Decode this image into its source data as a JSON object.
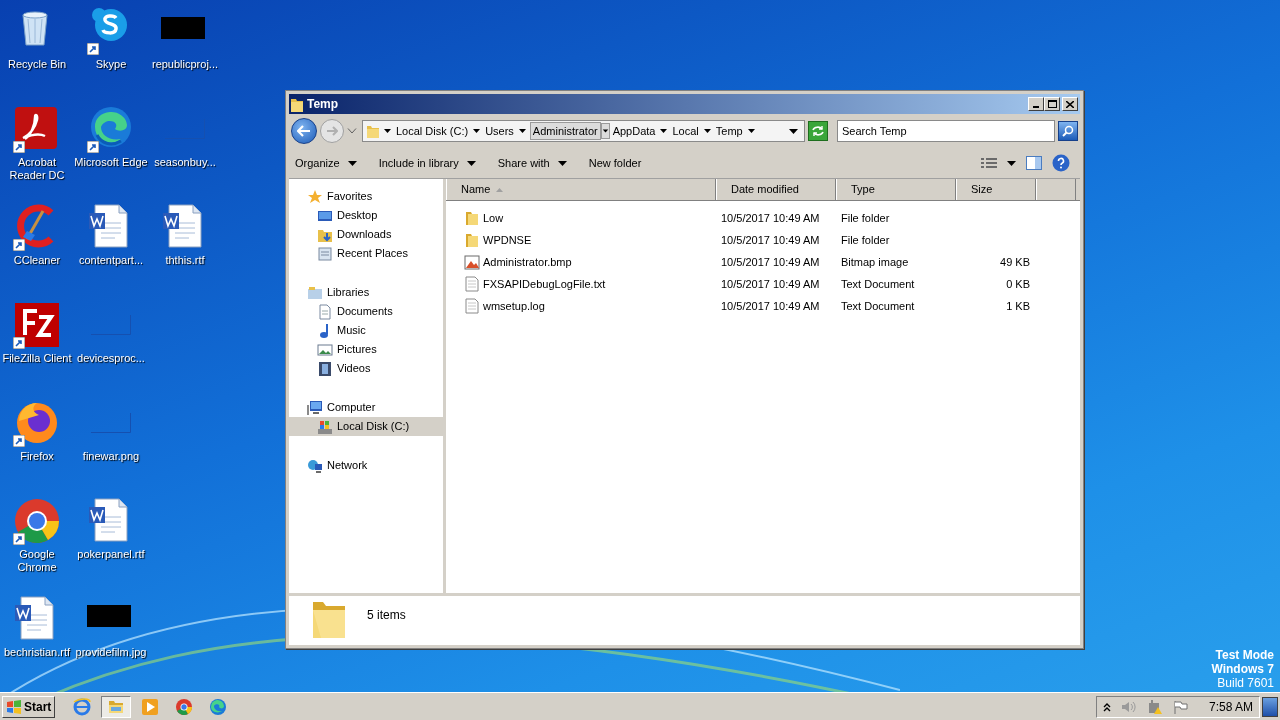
{
  "desktop": {
    "rows": [
      [
        {
          "label": "Recycle Bin",
          "kind": "recycle",
          "shortcut": false
        },
        {
          "label": "Skype",
          "kind": "skype",
          "shortcut": true
        },
        {
          "label": "republicproj...",
          "kind": "dark-thumb",
          "shortcut": false
        }
      ],
      [
        {
          "label": "Acrobat Reader DC",
          "kind": "acrobat",
          "shortcut": true
        },
        {
          "label": "Microsoft Edge",
          "kind": "edge",
          "shortcut": true
        },
        {
          "label": "seasonbuy...",
          "kind": "blank-thumb",
          "shortcut": false
        }
      ],
      [
        {
          "label": "CCleaner",
          "kind": "ccleaner",
          "shortcut": true
        },
        {
          "label": "contentpart...",
          "kind": "word",
          "shortcut": false
        },
        {
          "label": "ththis.rtf",
          "kind": "word",
          "shortcut": false
        }
      ],
      [
        {
          "label": "FileZilla Client",
          "kind": "filezilla",
          "shortcut": true
        },
        {
          "label": "devicesproc...",
          "kind": "blank-thumb",
          "shortcut": false
        }
      ],
      [
        {
          "label": "Firefox",
          "kind": "firefox",
          "shortcut": true
        },
        {
          "label": "finewar.png",
          "kind": "blank-thumb",
          "shortcut": false
        }
      ],
      [
        {
          "label": "Google Chrome",
          "kind": "chrome",
          "shortcut": true
        },
        {
          "label": "pokerpanel.rtf",
          "kind": "word",
          "shortcut": false
        }
      ],
      [
        {
          "label": "bechristian.rtf",
          "kind": "word",
          "shortcut": false
        },
        {
          "label": "providefilm.jpg",
          "kind": "dark-thumb",
          "shortcut": false
        }
      ]
    ]
  },
  "window": {
    "title": "Temp",
    "breadcrumbs": [
      {
        "label": "Local Disk (C:)",
        "hovered": false
      },
      {
        "label": "Users",
        "hovered": false
      },
      {
        "label": "Administrator",
        "hovered": true
      },
      {
        "label": "AppData",
        "hovered": false
      },
      {
        "label": "Local",
        "hovered": false
      },
      {
        "label": "Temp",
        "hovered": false
      }
    ],
    "search": {
      "placeholder": "Search Temp"
    },
    "toolbar": [
      {
        "label": "Organize",
        "dropdown": true
      },
      {
        "label": "Include in library",
        "dropdown": true
      },
      {
        "label": "Share with",
        "dropdown": true
      },
      {
        "label": "New folder",
        "dropdown": false
      }
    ],
    "nav": [
      {
        "label": "Favorites",
        "kind": "star",
        "selected": false,
        "children": [
          {
            "label": "Desktop",
            "kind": "desktop",
            "selected": false
          },
          {
            "label": "Downloads",
            "kind": "downloads",
            "selected": false
          },
          {
            "label": "Recent Places",
            "kind": "recent",
            "selected": false
          }
        ]
      },
      {
        "label": "Libraries",
        "kind": "libraries",
        "selected": false,
        "children": [
          {
            "label": "Documents",
            "kind": "documents",
            "selected": false
          },
          {
            "label": "Music",
            "kind": "music",
            "selected": false
          },
          {
            "label": "Pictures",
            "kind": "pictures",
            "selected": false
          },
          {
            "label": "Videos",
            "kind": "videos",
            "selected": false
          }
        ]
      },
      {
        "label": "Computer",
        "kind": "computer",
        "selected": false,
        "children": [
          {
            "label": "Local Disk (C:)",
            "kind": "disk",
            "selected": true
          }
        ]
      },
      {
        "label": "Network",
        "kind": "network",
        "selected": false
      }
    ],
    "columns": [
      {
        "label": "Name",
        "sorted": true
      },
      {
        "label": "Date modified",
        "sorted": false
      },
      {
        "label": "Type",
        "sorted": false
      },
      {
        "label": "Size",
        "sorted": false
      }
    ],
    "files": [
      {
        "name": "Low",
        "date": "10/5/2017 10:49 AM",
        "type": "File folder",
        "kind": "folder"
      },
      {
        "name": "WPDNSE",
        "date": "10/5/2017 10:49 AM",
        "type": "File folder",
        "kind": "folder"
      },
      {
        "name": "Administrator.bmp",
        "date": "10/5/2017 10:49 AM",
        "type": "Bitmap image",
        "size": "49 KB",
        "kind": "image"
      },
      {
        "name": "FXSAPIDebugLogFile.txt",
        "date": "10/5/2017 10:49 AM",
        "type": "Text Document",
        "size": "0 KB",
        "kind": "text"
      },
      {
        "name": "wmsetup.log",
        "date": "10/5/2017 10:49 AM",
        "type": "Text Document",
        "size": "1 KB",
        "kind": "text"
      }
    ],
    "status": "5 items"
  },
  "desktop_notice": [
    "Test Mode",
    "Windows 7",
    "Build 7601"
  ],
  "taskbar": {
    "start": "Start",
    "apps": [
      {
        "kind": "ie",
        "active": false
      },
      {
        "kind": "explorer",
        "active": true
      },
      {
        "kind": "media",
        "active": false
      },
      {
        "kind": "chrome",
        "active": false
      },
      {
        "kind": "edge",
        "active": false
      }
    ],
    "time": "7:58 AM"
  }
}
